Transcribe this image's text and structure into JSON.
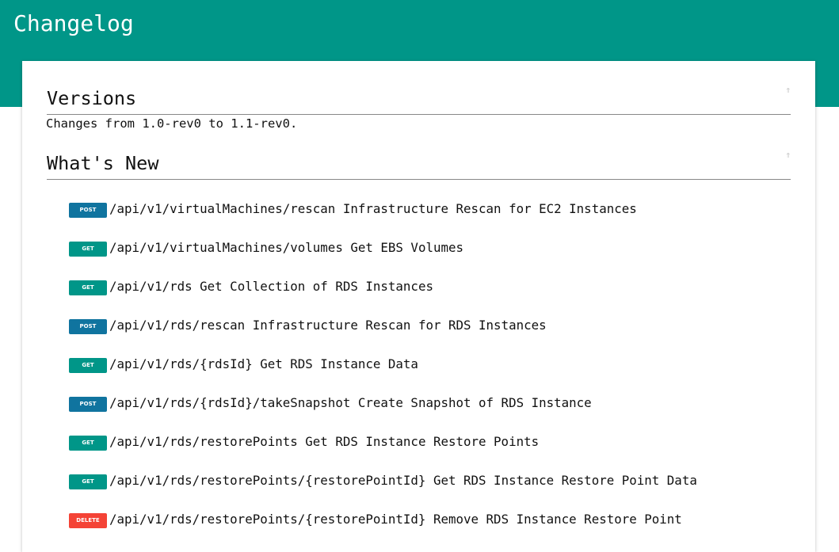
{
  "header": {
    "title": "Changelog"
  },
  "colors": {
    "header": "#009688",
    "POST": "#10749f",
    "GET": "#009688",
    "DELETE": "#f44336"
  },
  "versions": {
    "title": "Versions",
    "description": "Changes from 1.0-rev0 to 1.1-rev0.",
    "top_icon": "⇑"
  },
  "whats_new": {
    "title": "What's New",
    "top_icon": "⇑",
    "endpoints": [
      {
        "method": "POST",
        "path": "/api/v1/virtualMachines/rescan",
        "summary": "Infrastructure Rescan for EC2 Instances"
      },
      {
        "method": "GET",
        "path": "/api/v1/virtualMachines/volumes",
        "summary": "Get EBS Volumes"
      },
      {
        "method": "GET",
        "path": "/api/v1/rds",
        "summary": "Get Collection of RDS Instances"
      },
      {
        "method": "POST",
        "path": "/api/v1/rds/rescan",
        "summary": "Infrastructure Rescan for RDS Instances"
      },
      {
        "method": "GET",
        "path": "/api/v1/rds/{rdsId}",
        "summary": "Get RDS Instance Data"
      },
      {
        "method": "POST",
        "path": "/api/v1/rds/{rdsId}/takeSnapshot",
        "summary": "Create Snapshot of RDS Instance"
      },
      {
        "method": "GET",
        "path": "/api/v1/rds/restorePoints",
        "summary": "Get RDS Instance Restore Points"
      },
      {
        "method": "GET",
        "path": "/api/v1/rds/restorePoints/{restorePointId}",
        "summary": "Get RDS Instance Restore Point Data"
      },
      {
        "method": "DELETE",
        "path": "/api/v1/rds/restorePoints/{restorePointId}",
        "summary": "Remove RDS Instance Restore Point"
      }
    ]
  }
}
